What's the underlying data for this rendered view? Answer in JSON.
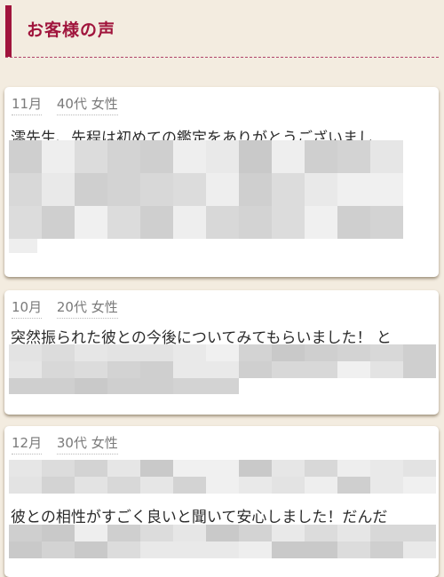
{
  "header": {
    "title": "お客様の声",
    "accent_color": "#a0143c"
  },
  "testimonials": [
    {
      "month": "11月",
      "age": "40代",
      "gender": "女性",
      "text": "澪先生、先程は初めての鑑定をありがとうございまし",
      "pixelated": true
    },
    {
      "month": "10月",
      "age": "20代",
      "gender": "女性",
      "text": "突然振られた彼との今後についてみてもらいました！ と",
      "pixelated": true
    },
    {
      "month": "12月",
      "age": "30代",
      "gender": "女性",
      "text": "彼との相性がすごく良いと聞いて安心しました！だんだ",
      "pixelated": true
    }
  ]
}
